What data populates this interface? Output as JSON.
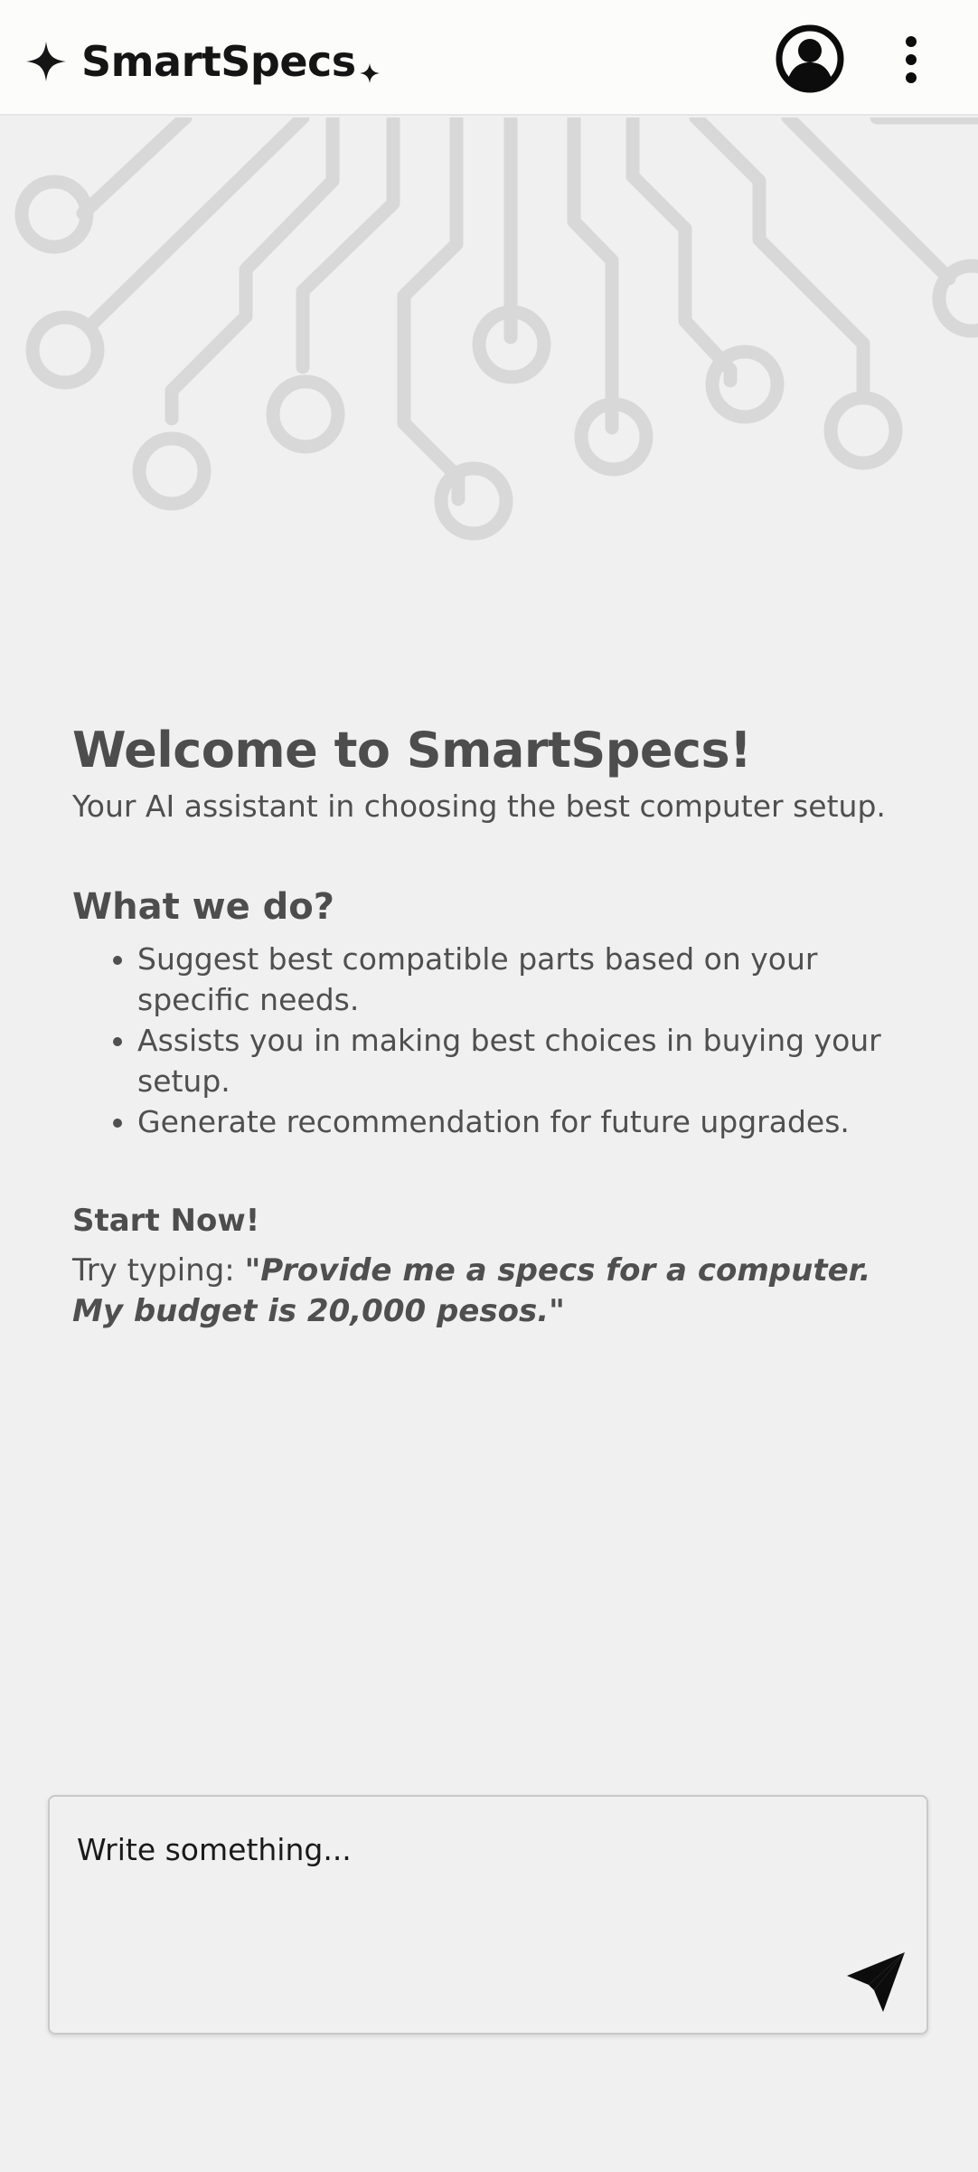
{
  "header": {
    "brand_name": "SmartSpecs",
    "icons": {
      "logo": "sparkle-icon",
      "account": "account-circle-icon",
      "menu": "more-vert-icon"
    },
    "colors": {
      "header_bg": "#fcfcfa",
      "brand_text": "#151515"
    }
  },
  "welcome": {
    "title": "Welcome to SmartSpecs!",
    "subtitle": "Your AI assistant in choosing the best computer setup."
  },
  "features": {
    "title": "What we do?",
    "items": [
      "Suggest best compatible parts based on your specific needs.",
      "Assists you in making best choices in buying your setup.",
      "Generate recommendation for future upgrades."
    ]
  },
  "start": {
    "title": "Start Now!",
    "prompt_prefix": "Try typing: ",
    "prompt_example": "\"Provide me a specs for a computer. My budget is 20,000 pesos.\""
  },
  "composer": {
    "placeholder": "Write something...",
    "value": "",
    "send_icon": "send-icon"
  },
  "colors": {
    "page_bg": "#f0f0f0",
    "text": "#4f4f4f",
    "circuit": "#d6d6d6"
  }
}
